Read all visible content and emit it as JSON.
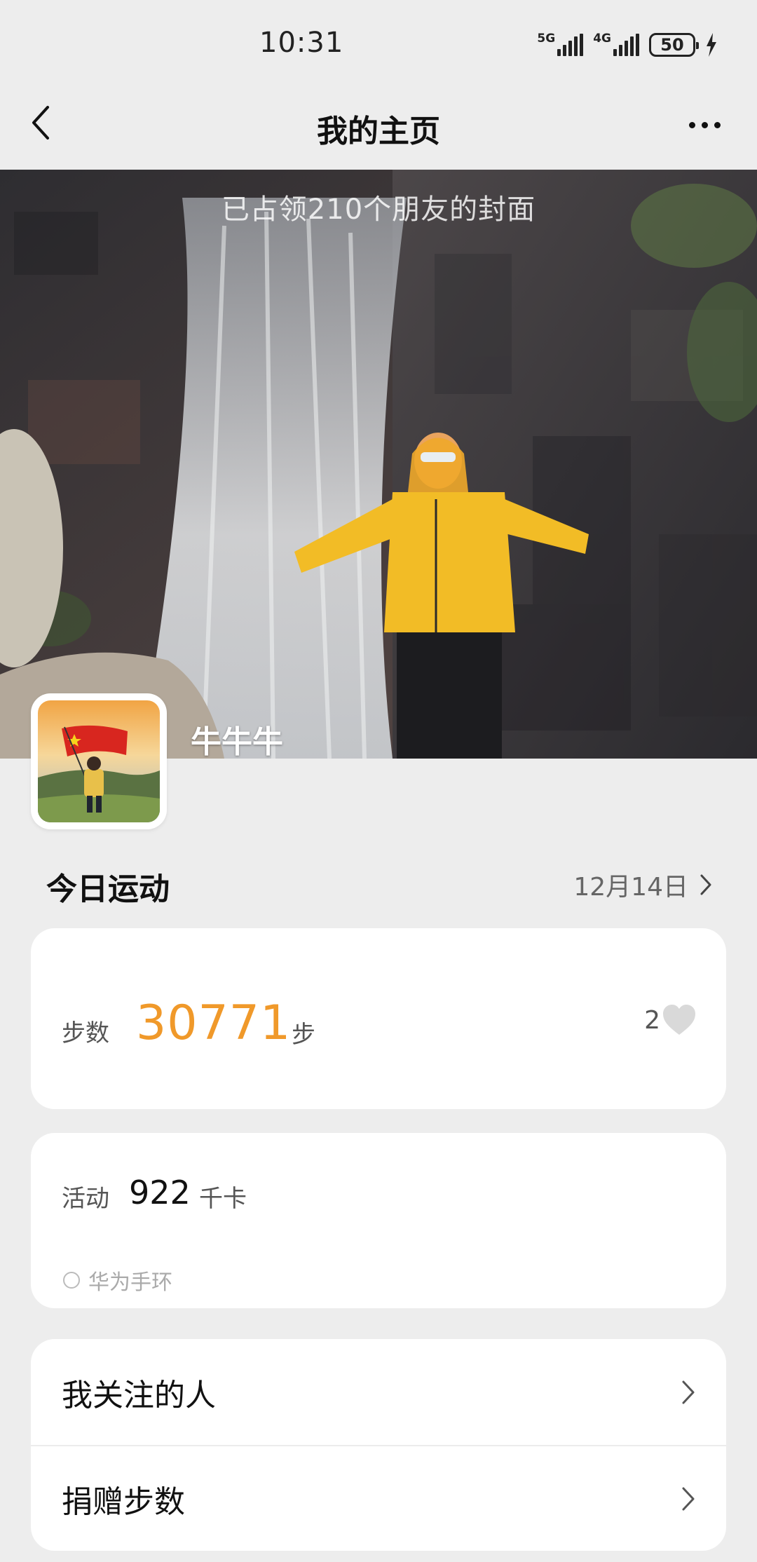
{
  "status_bar": {
    "time": "10:31",
    "network1": "5G",
    "network2": "4G",
    "battery": "50"
  },
  "nav": {
    "title": "我的主页"
  },
  "cover": {
    "caption": "已占领210个朋友的封面",
    "username": "牛牛牛"
  },
  "today": {
    "title": "今日运动",
    "date": "12月14日"
  },
  "steps": {
    "label": "步数",
    "value": "30771",
    "unit": "步",
    "likes": "2"
  },
  "activity": {
    "label": "活动",
    "value": "922",
    "unit": "千卡",
    "device": "华为手环"
  },
  "menu": {
    "items": [
      {
        "label": "我关注的人"
      },
      {
        "label": "捐赠步数"
      }
    ]
  },
  "colors": {
    "accent_orange": "#f0992a",
    "background": "#ededed"
  }
}
